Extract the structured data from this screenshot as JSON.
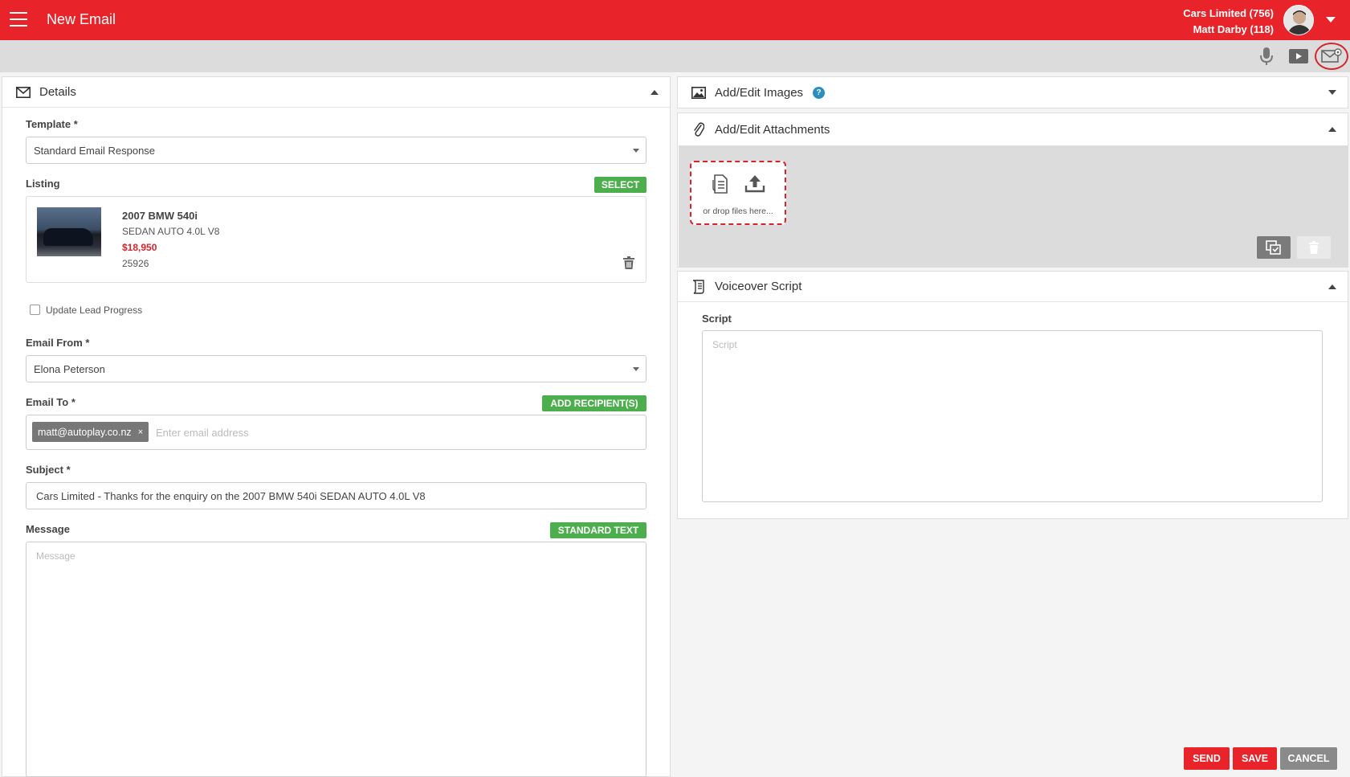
{
  "header": {
    "title": "New Email",
    "account_line1": "Cars Limited (756)",
    "account_line2": "Matt Darby (118)"
  },
  "toolbar": {
    "icons": [
      "microphone-icon",
      "video-play-icon",
      "email-settings-icon"
    ]
  },
  "details": {
    "heading": "Details",
    "template_label": "Template *",
    "template_value": "Standard Email Response",
    "listing_label": "Listing",
    "select_button": "SELECT",
    "listing": {
      "title": "2007 BMW 540i",
      "subtitle": "SEDAN AUTO 4.0L V8",
      "price": "$18,950",
      "stock_id": "25926"
    },
    "update_lead_label": "Update Lead Progress",
    "email_from_label": "Email From *",
    "email_from_value": "Elona Peterson",
    "email_to_label": "Email To *",
    "add_recipients_button": "ADD RECIPIENT(S)",
    "recipient_chip": "matt@autoplay.co.nz",
    "recipient_remove": "×",
    "email_to_placeholder": "Enter email address",
    "subject_label": "Subject *",
    "subject_value": "Cars Limited - Thanks for the enquiry on the 2007 BMW 540i SEDAN AUTO 4.0L V8",
    "message_label": "Message",
    "standard_text_button": "STANDARD TEXT",
    "message_placeholder": "Message"
  },
  "images": {
    "heading": "Add/Edit Images"
  },
  "attachments": {
    "heading": "Add/Edit Attachments",
    "drop_text": "or drop files here..."
  },
  "voiceover": {
    "heading": "Voiceover Script",
    "script_label": "Script",
    "script_placeholder": "Script"
  },
  "actions": {
    "send": "SEND",
    "save": "SAVE",
    "cancel": "CANCEL"
  },
  "colors": {
    "brand": "#e8242a",
    "green": "#4cae4c",
    "gray": "#8a8a8a"
  }
}
